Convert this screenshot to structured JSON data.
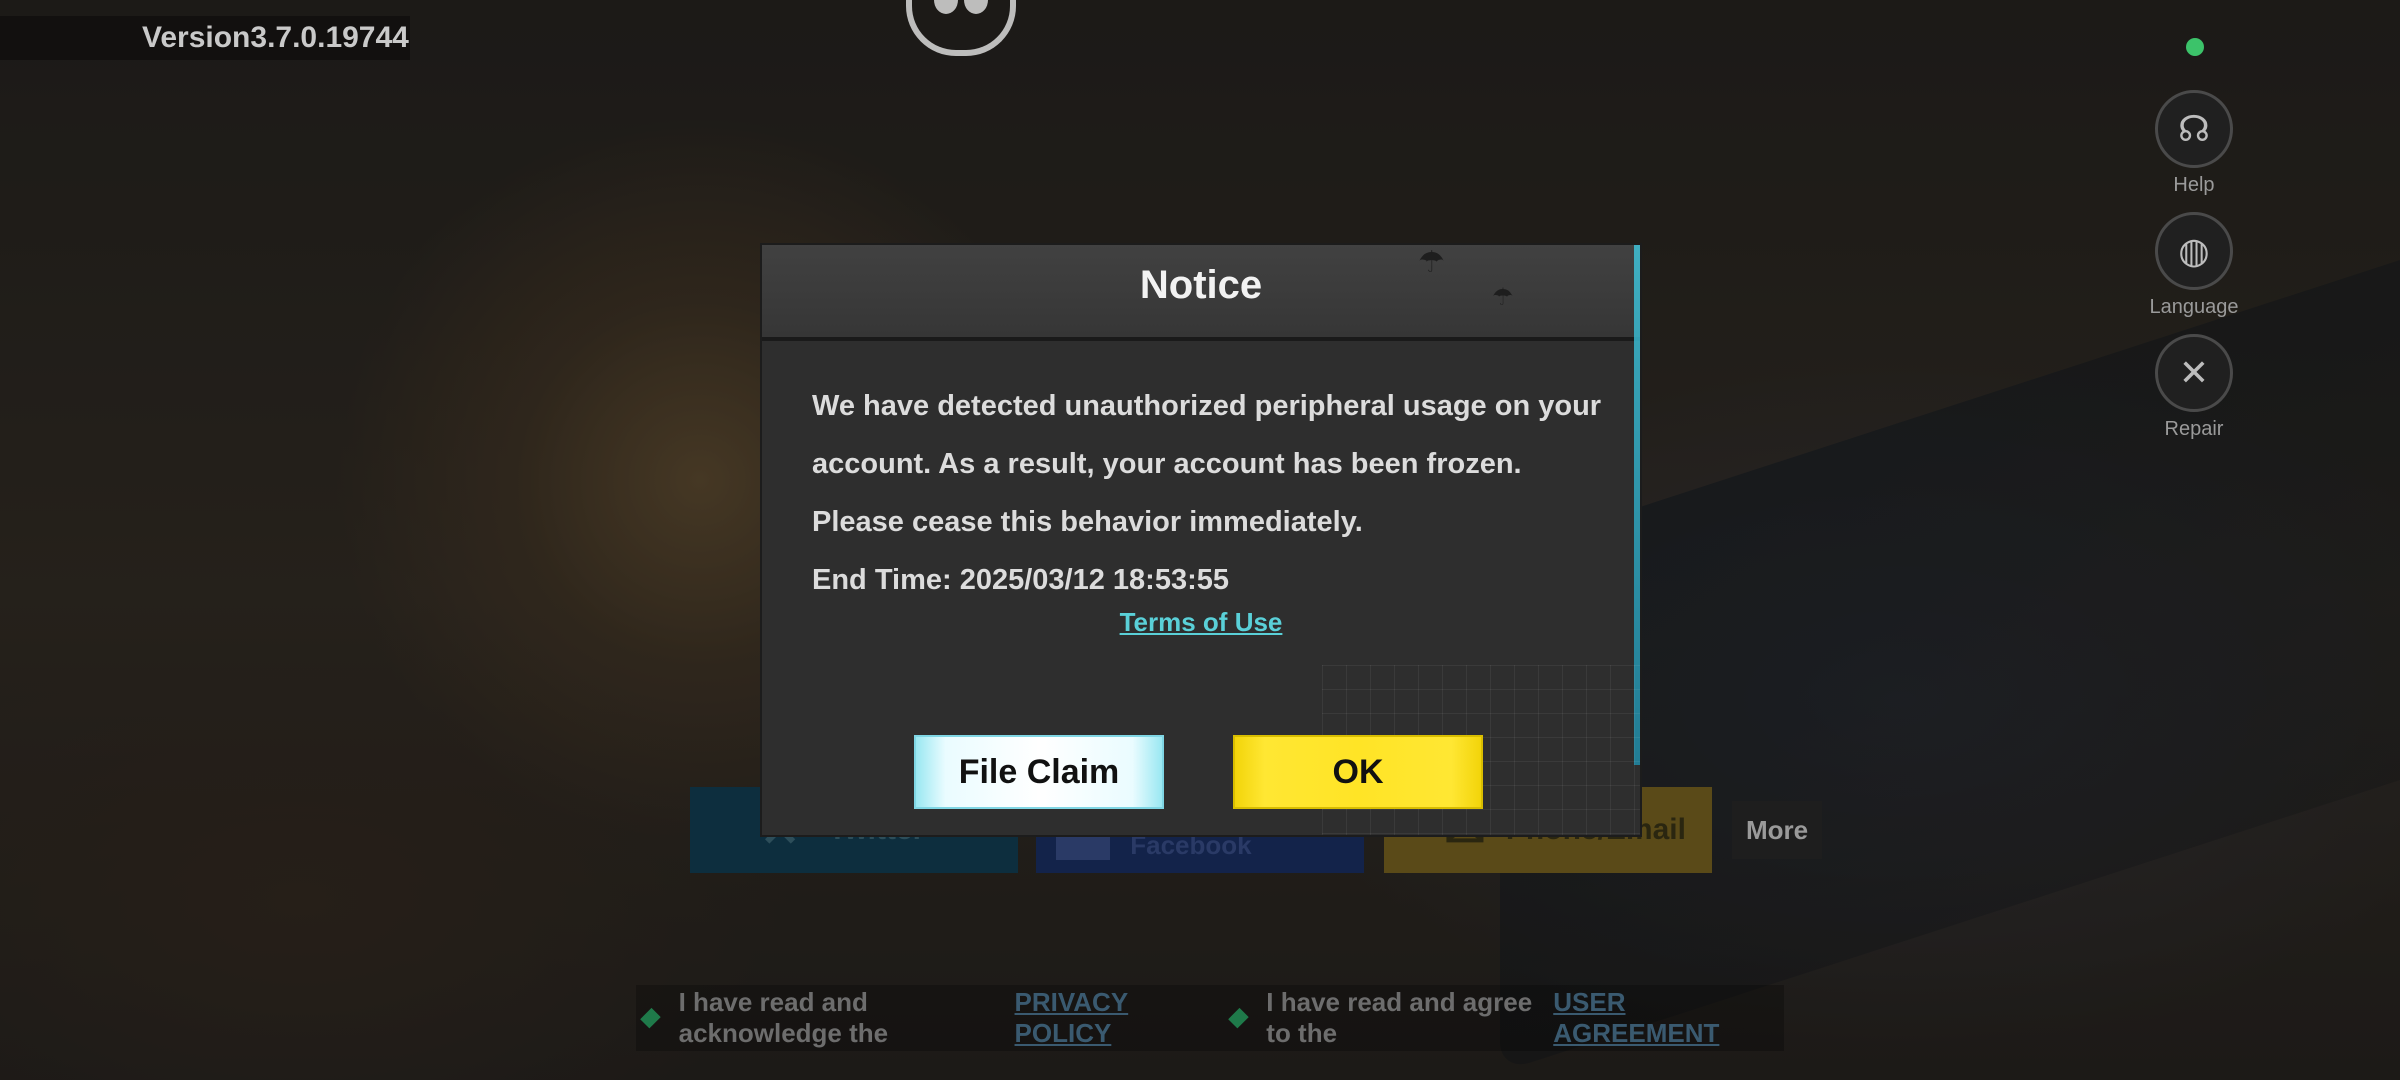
{
  "header": {
    "version": "Version3.7.0.19744"
  },
  "side_menu": {
    "items": [
      {
        "label": "Help",
        "icon": "headset-icon"
      },
      {
        "label": "Language",
        "icon": "globe-icon"
      },
      {
        "label": "Repair",
        "icon": "wrench-icon"
      }
    ],
    "status_color": "#3cc36a"
  },
  "login": {
    "twitter_label": "Twitter",
    "facebook_label": "Login with Facebook",
    "phone_label": "Phone/Email",
    "more_label": "More"
  },
  "agreement": {
    "privacy_text": "I have read and acknowledge the",
    "privacy_link": "PRIVACY POLICY",
    "user_text": "I have read and agree to the",
    "user_link": "USER AGREEMENT"
  },
  "dialog": {
    "title": "Notice",
    "message": "We have detected unauthorized peripheral usage on your account. As a result, your account has been frozen. Please cease this behavior immediately.",
    "end_time": "End Time: 2025/03/12 18:53:55",
    "terms_link": "Terms of Use",
    "file_claim_label": "File Claim",
    "ok_label": "OK",
    "colors": {
      "ok": "#ffe426",
      "claim": "#eafcff",
      "link": "#5ad0d8"
    }
  }
}
